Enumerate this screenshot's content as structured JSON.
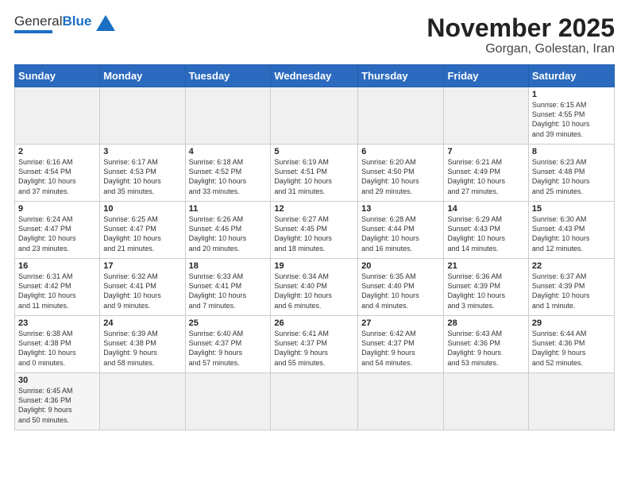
{
  "logo": {
    "general": "General",
    "blue": "Blue"
  },
  "title": "November 2025",
  "subtitle": "Gorgan, Golestan, Iran",
  "weekdays": [
    "Sunday",
    "Monday",
    "Tuesday",
    "Wednesday",
    "Thursday",
    "Friday",
    "Saturday"
  ],
  "weeks": [
    [
      {
        "day": "",
        "info": ""
      },
      {
        "day": "",
        "info": ""
      },
      {
        "day": "",
        "info": ""
      },
      {
        "day": "",
        "info": ""
      },
      {
        "day": "",
        "info": ""
      },
      {
        "day": "",
        "info": ""
      },
      {
        "day": "1",
        "info": "Sunrise: 6:15 AM\nSunset: 4:55 PM\nDaylight: 10 hours\nand 39 minutes."
      }
    ],
    [
      {
        "day": "2",
        "info": "Sunrise: 6:16 AM\nSunset: 4:54 PM\nDaylight: 10 hours\nand 37 minutes."
      },
      {
        "day": "3",
        "info": "Sunrise: 6:17 AM\nSunset: 4:53 PM\nDaylight: 10 hours\nand 35 minutes."
      },
      {
        "day": "4",
        "info": "Sunrise: 6:18 AM\nSunset: 4:52 PM\nDaylight: 10 hours\nand 33 minutes."
      },
      {
        "day": "5",
        "info": "Sunrise: 6:19 AM\nSunset: 4:51 PM\nDaylight: 10 hours\nand 31 minutes."
      },
      {
        "day": "6",
        "info": "Sunrise: 6:20 AM\nSunset: 4:50 PM\nDaylight: 10 hours\nand 29 minutes."
      },
      {
        "day": "7",
        "info": "Sunrise: 6:21 AM\nSunset: 4:49 PM\nDaylight: 10 hours\nand 27 minutes."
      },
      {
        "day": "8",
        "info": "Sunrise: 6:23 AM\nSunset: 4:48 PM\nDaylight: 10 hours\nand 25 minutes."
      }
    ],
    [
      {
        "day": "9",
        "info": "Sunrise: 6:24 AM\nSunset: 4:47 PM\nDaylight: 10 hours\nand 23 minutes."
      },
      {
        "day": "10",
        "info": "Sunrise: 6:25 AM\nSunset: 4:47 PM\nDaylight: 10 hours\nand 21 minutes."
      },
      {
        "day": "11",
        "info": "Sunrise: 6:26 AM\nSunset: 4:46 PM\nDaylight: 10 hours\nand 20 minutes."
      },
      {
        "day": "12",
        "info": "Sunrise: 6:27 AM\nSunset: 4:45 PM\nDaylight: 10 hours\nand 18 minutes."
      },
      {
        "day": "13",
        "info": "Sunrise: 6:28 AM\nSunset: 4:44 PM\nDaylight: 10 hours\nand 16 minutes."
      },
      {
        "day": "14",
        "info": "Sunrise: 6:29 AM\nSunset: 4:43 PM\nDaylight: 10 hours\nand 14 minutes."
      },
      {
        "day": "15",
        "info": "Sunrise: 6:30 AM\nSunset: 4:43 PM\nDaylight: 10 hours\nand 12 minutes."
      }
    ],
    [
      {
        "day": "16",
        "info": "Sunrise: 6:31 AM\nSunset: 4:42 PM\nDaylight: 10 hours\nand 11 minutes."
      },
      {
        "day": "17",
        "info": "Sunrise: 6:32 AM\nSunset: 4:41 PM\nDaylight: 10 hours\nand 9 minutes."
      },
      {
        "day": "18",
        "info": "Sunrise: 6:33 AM\nSunset: 4:41 PM\nDaylight: 10 hours\nand 7 minutes."
      },
      {
        "day": "19",
        "info": "Sunrise: 6:34 AM\nSunset: 4:40 PM\nDaylight: 10 hours\nand 6 minutes."
      },
      {
        "day": "20",
        "info": "Sunrise: 6:35 AM\nSunset: 4:40 PM\nDaylight: 10 hours\nand 4 minutes."
      },
      {
        "day": "21",
        "info": "Sunrise: 6:36 AM\nSunset: 4:39 PM\nDaylight: 10 hours\nand 3 minutes."
      },
      {
        "day": "22",
        "info": "Sunrise: 6:37 AM\nSunset: 4:39 PM\nDaylight: 10 hours\nand 1 minute."
      }
    ],
    [
      {
        "day": "23",
        "info": "Sunrise: 6:38 AM\nSunset: 4:38 PM\nDaylight: 10 hours\nand 0 minutes."
      },
      {
        "day": "24",
        "info": "Sunrise: 6:39 AM\nSunset: 4:38 PM\nDaylight: 9 hours\nand 58 minutes."
      },
      {
        "day": "25",
        "info": "Sunrise: 6:40 AM\nSunset: 4:37 PM\nDaylight: 9 hours\nand 57 minutes."
      },
      {
        "day": "26",
        "info": "Sunrise: 6:41 AM\nSunset: 4:37 PM\nDaylight: 9 hours\nand 55 minutes."
      },
      {
        "day": "27",
        "info": "Sunrise: 6:42 AM\nSunset: 4:37 PM\nDaylight: 9 hours\nand 54 minutes."
      },
      {
        "day": "28",
        "info": "Sunrise: 6:43 AM\nSunset: 4:36 PM\nDaylight: 9 hours\nand 53 minutes."
      },
      {
        "day": "29",
        "info": "Sunrise: 6:44 AM\nSunset: 4:36 PM\nDaylight: 9 hours\nand 52 minutes."
      }
    ],
    [
      {
        "day": "30",
        "info": "Sunrise: 6:45 AM\nSunset: 4:36 PM\nDaylight: 9 hours\nand 50 minutes."
      },
      {
        "day": "",
        "info": ""
      },
      {
        "day": "",
        "info": ""
      },
      {
        "day": "",
        "info": ""
      },
      {
        "day": "",
        "info": ""
      },
      {
        "day": "",
        "info": ""
      },
      {
        "day": "",
        "info": ""
      }
    ]
  ]
}
